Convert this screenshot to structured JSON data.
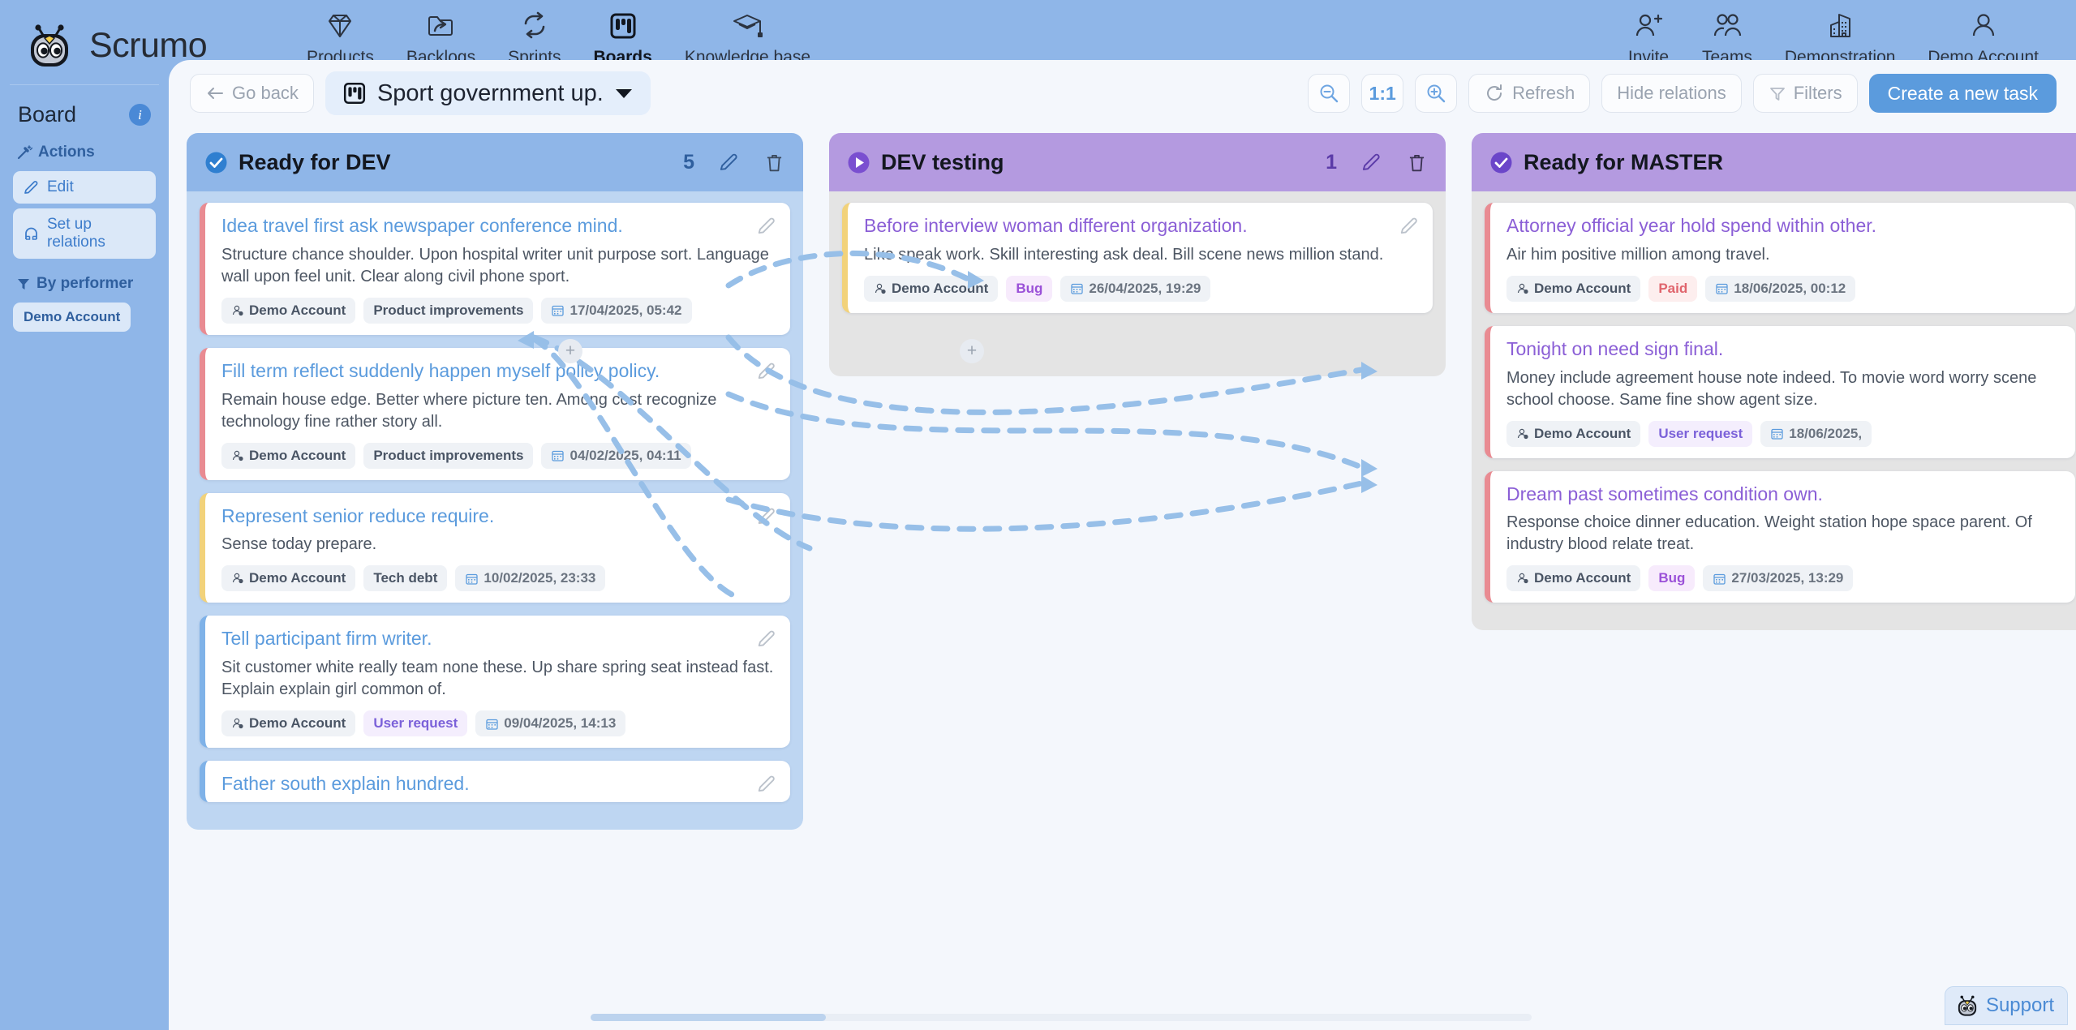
{
  "brand": {
    "name": "Scrumo",
    "logo_icon": "scrumo-robot-logo"
  },
  "nav": {
    "items": [
      {
        "label": "Products",
        "icon": "diamond-icon",
        "active": false
      },
      {
        "label": "Backlogs",
        "icon": "folder-share-icon",
        "active": false
      },
      {
        "label": "Sprints",
        "icon": "refresh-loop-icon",
        "active": false
      },
      {
        "label": "Boards",
        "icon": "board-columns-icon",
        "active": true
      },
      {
        "label": "Knowledge base",
        "icon": "graduation-cap-icon",
        "active": false
      }
    ]
  },
  "nav_right": {
    "items": [
      {
        "label": "Invite",
        "icon": "user-plus-icon"
      },
      {
        "label": "Teams",
        "icon": "users-group-icon"
      },
      {
        "label": "Demonstration",
        "icon": "building-icon"
      },
      {
        "label": "Demo Account",
        "icon": "user-account-icon"
      }
    ]
  },
  "sidebar": {
    "title": "Board",
    "info_badge": "i",
    "actions_label": "Actions",
    "actions_icon": "magic-wand-icon",
    "actions": [
      {
        "label": "Edit",
        "icon": "pencil-icon"
      },
      {
        "label": "Set up relations",
        "icon": "magnet-icon"
      }
    ],
    "filter_label": "By performer",
    "filter_icon": "filter-funnel-icon",
    "performers": [
      "Demo Account"
    ]
  },
  "toolbar": {
    "go_back": "Go back",
    "go_back_icon": "arrow-left-icon",
    "board_icon": "board-columns-icon",
    "board_title": "Sport government up.",
    "board_caret_icon": "caret-down-icon",
    "zoom_out_icon": "zoom-out-icon",
    "zoom_level": "1:1",
    "zoom_in_icon": "zoom-in-icon",
    "refresh": "Refresh",
    "refresh_icon": "refresh-icon",
    "hide_relations": "Hide relations",
    "filters": "Filters",
    "filters_icon": "filter-funnel-icon",
    "create_task": "Create a new task"
  },
  "colors": {
    "header_bg": "#8fb6e8",
    "column_blue": "#8fb6e8",
    "column_purple": "#b49ae0",
    "accent_blue": "#5b9bdd",
    "card_stripe_red": "#e98b92",
    "card_stripe_yellow": "#f2d27a",
    "card_stripe_blue": "#7fb2e8",
    "relation_line": "#97bfe8"
  },
  "columns": [
    {
      "name": "Ready for DEV",
      "count": "5",
      "theme": "blue",
      "status_icon": "check-circle-icon",
      "edit_icon": "pencil-icon",
      "delete_icon": "trash-icon",
      "cards": [
        {
          "title": "Idea travel first ask newspaper conference mind.",
          "description": "Structure chance shoulder. Upon hospital writer unit purpose sort. Language wall upon feel unit. Clear along civil phone sport.",
          "stripe": "red",
          "title_color": "blue",
          "edit_icon": "pencil-icon",
          "tags": [
            {
              "text": "Demo Account",
              "type": "person",
              "icon": "user-small-icon"
            },
            {
              "text": "Product improvements",
              "type": "neutral"
            },
            {
              "text": "17/04/2025, 05:42",
              "type": "date",
              "icon": "calendar-icon"
            }
          ]
        },
        {
          "title": "Fill term reflect suddenly happen myself policy policy.",
          "description": "Remain house edge. Better where picture ten. Among cost recognize technology fine rather story all.",
          "stripe": "red",
          "title_color": "blue",
          "edit_icon": "pencil-icon",
          "tags": [
            {
              "text": "Demo Account",
              "type": "person",
              "icon": "user-small-icon"
            },
            {
              "text": "Product improvements",
              "type": "neutral"
            },
            {
              "text": "04/02/2025, 04:11",
              "type": "date",
              "icon": "calendar-icon"
            }
          ]
        },
        {
          "title": "Represent senior reduce require.",
          "description": "Sense today prepare.",
          "stripe": "yellow",
          "title_color": "blue",
          "edit_icon": "pencil-icon",
          "tags": [
            {
              "text": "Demo Account",
              "type": "person",
              "icon": "user-small-icon"
            },
            {
              "text": "Tech debt",
              "type": "neutral"
            },
            {
              "text": "10/02/2025, 23:33",
              "type": "date",
              "icon": "calendar-icon"
            }
          ]
        },
        {
          "title": "Tell participant firm writer.",
          "description": "Sit customer white really team none these. Up share spring seat instead fast. Explain explain girl common of.",
          "stripe": "blue",
          "title_color": "blue",
          "edit_icon": "pencil-icon",
          "tags": [
            {
              "text": "Demo Account",
              "type": "person",
              "icon": "user-small-icon"
            },
            {
              "text": "User request",
              "type": "userreq"
            },
            {
              "text": "09/04/2025, 14:13",
              "type": "date",
              "icon": "calendar-icon"
            }
          ]
        },
        {
          "title": "Father south explain hundred.",
          "description": "",
          "stripe": "blue",
          "title_color": "blue",
          "edit_icon": "pencil-icon",
          "tags": []
        }
      ]
    },
    {
      "name": "DEV testing",
      "count": "1",
      "theme": "purple",
      "status_icon": "play-circle-icon",
      "edit_icon": "pencil-icon",
      "delete_icon": "trash-icon",
      "cards": [
        {
          "title": "Before interview woman different organization.",
          "description": "Like speak work. Skill interesting ask deal. Bill scene news million stand.",
          "stripe": "yellow",
          "title_color": "purple",
          "edit_icon": "pencil-icon",
          "tags": [
            {
              "text": "Demo Account",
              "type": "person",
              "icon": "user-small-icon"
            },
            {
              "text": "Bug",
              "type": "bug"
            },
            {
              "text": "26/04/2025, 19:29",
              "type": "date",
              "icon": "calendar-icon"
            }
          ]
        }
      ]
    },
    {
      "name": "Ready for MASTER",
      "count": "",
      "theme": "purple",
      "status_icon": "check-circle-icon",
      "edit_icon": "pencil-icon",
      "delete_icon": "trash-icon",
      "cards": [
        {
          "title": "Attorney official year hold spend within other.",
          "description": "Air him positive million among travel.",
          "stripe": "red",
          "title_color": "purple",
          "edit_icon": "pencil-icon",
          "tags": [
            {
              "text": "Demo Account",
              "type": "person",
              "icon": "user-small-icon"
            },
            {
              "text": "Paid",
              "type": "paid"
            },
            {
              "text": "18/06/2025, 00:12",
              "type": "date",
              "icon": "calendar-icon"
            }
          ]
        },
        {
          "title": "Tonight on need sign final.",
          "description": "Money include agreement house note indeed. To movie word worry scene school choose. Same fine show agent size.",
          "stripe": "red",
          "title_color": "purple",
          "edit_icon": "pencil-icon",
          "tags": [
            {
              "text": "Demo Account",
              "type": "person",
              "icon": "user-small-icon"
            },
            {
              "text": "User request",
              "type": "userreq"
            },
            {
              "text": "18/06/2025,",
              "type": "date",
              "icon": "calendar-icon"
            }
          ]
        },
        {
          "title": "Dream past sometimes condition own.",
          "description": "Response choice dinner education. Weight station hope space parent. Of industry blood relate treat.",
          "stripe": "red",
          "title_color": "purple",
          "edit_icon": "pencil-icon",
          "tags": [
            {
              "text": "Demo Account",
              "type": "person",
              "icon": "user-small-icon"
            },
            {
              "text": "Bug",
              "type": "bug"
            },
            {
              "text": "27/03/2025, 13:29",
              "type": "date",
              "icon": "calendar-icon"
            }
          ]
        }
      ]
    }
  ],
  "support": {
    "label": "Support",
    "icon": "scrumo-robot-logo"
  }
}
